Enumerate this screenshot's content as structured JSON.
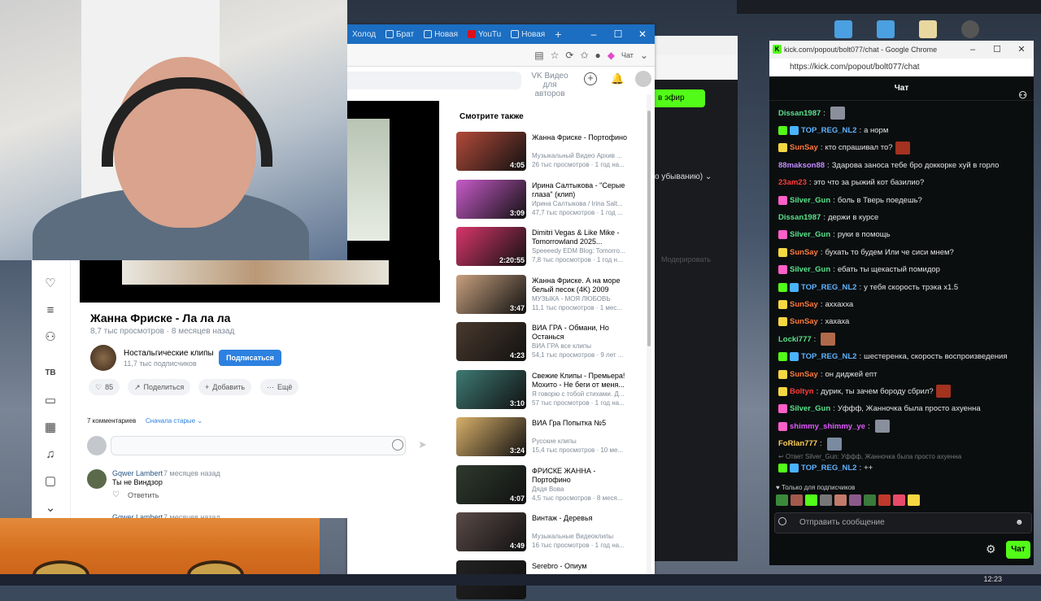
{
  "vk_window": {
    "tabs": [
      "Холод",
      "Брат",
      "Новая",
      "YouTu",
      "Новая"
    ],
    "header_title": "VK Видео для авторов",
    "video": {
      "title": "Жанна Фриске - Ла ла ла",
      "views": "8,7 тыс просмотров",
      "dot": "·",
      "age": "8 месяцев назад",
      "channel": "Ностальгические клипы",
      "subscribers": "11,7 тыс подписчиков",
      "subscribe_label": "Подписаться",
      "likes": "85",
      "share_label": "Поделиться",
      "add_label": "Добавить",
      "more_label": "Ещё"
    },
    "comments": {
      "count_label": "7 комментариев",
      "sort_label": "Сначала старые",
      "list": [
        {
          "author": "Gqwer Lambert",
          "time": "7 месяцев назад",
          "text": "Ты не Виндзор",
          "reply_label": "Ответить"
        },
        {
          "author": "Gqwer Lambert",
          "time": "7 месяцев назад"
        }
      ]
    },
    "recommendations_title": "Смотрите также",
    "recommendations": [
      {
        "title": "Жанна Фриске - Портофино",
        "channel": "Музыкальный Видео Архив ...",
        "meta": "26 тыс просмотров · 1 год на...",
        "duration": "4:05",
        "color": "#b24a3a"
      },
      {
        "title": "Ирина Салтыкова - \"Серые глаза\" (клип)",
        "channel": "Ирина Салтыкова / Irina Salt...",
        "meta": "47,7 тыс просмотров · 1 год ...",
        "duration": "3:09",
        "color": "#c85bc9"
      },
      {
        "title": "Dimitri Vegas & Like Mike - Tomorrowland 2025...",
        "channel": "Speeeedy EDM Blog: Tomorro...",
        "meta": "7,8 тыс просмотров · 1 год н...",
        "duration": "2:20:55",
        "color": "#d8366b"
      },
      {
        "title": "Жанна Фриске. А на море белый песок (4K) 2009",
        "channel": "МУЗЫКА - МОЯ ЛЮБОВЬ",
        "meta": "11,1 тыс просмотров · 1 мес...",
        "duration": "3:47",
        "color": "#c7a07e"
      },
      {
        "title": "ВИА ГРА - Обмани, Но Останься",
        "channel": "ВИА ГРА все клипы",
        "meta": "54,1 тыс просмотров · 9 лет ...",
        "duration": "4:23",
        "color": "#4a3a2e"
      },
      {
        "title": "Свежие Клипы - Премьера! Мохито - Не беги от меня...",
        "channel": "Я говорю с тобой стихами. Д...",
        "meta": "57 тыс просмотров · 1 год на...",
        "duration": "3:10",
        "color": "#3e7a74"
      },
      {
        "title": "ВИА Гра Попытка №5",
        "channel": "Русские клипы",
        "meta": "15,4 тыс просмотров · 10 ме...",
        "duration": "3:24",
        "color": "#d9b06a"
      },
      {
        "title": "ФРИСКЕ ЖАННА - Портофино",
        "channel": "Дядя Вова",
        "meta": "4,5 тыс просмотров · 8 меся...",
        "duration": "4:07",
        "color": "#2e3a2e"
      },
      {
        "title": "Винтаж - Деревья",
        "channel": "Музыкальные Видеоклипы",
        "meta": "16 тыс просмотров · 1 год на...",
        "duration": "4:49",
        "color": "#5a4a48"
      },
      {
        "title": "Serebro - Опиум",
        "channel": "",
        "meta": "",
        "duration": "",
        "color": "#222222"
      }
    ]
  },
  "mid_window": {
    "live_label": "в эфир",
    "sort_label": "о убыванию)",
    "moderate_label": "Модерировать"
  },
  "chat_window": {
    "title": "kick.com/popout/bolt077/chat - Google Chrome",
    "url": "https://kick.com/popout/bolt077/chat",
    "header": "Чат",
    "messages": [
      {
        "user": "Dissan1987",
        "badges": [],
        "color": "#5be28c",
        "text": "",
        "emote": "#8a8f9c"
      },
      {
        "user": "TOP_REG_NL2",
        "badges": [
          "#53fc18",
          "#4ab3ff"
        ],
        "color": "#5fb3ff",
        "text": "а норм"
      },
      {
        "user": "SunSay",
        "badges": [
          "#f5d742"
        ],
        "color": "#ff7a3d",
        "text": "кто спрашивал то?",
        "emote": "#a3321f"
      },
      {
        "user": "88makson88",
        "badges": [],
        "color": "#c18cff",
        "text": "Здарова заноса тебе бро доккорке хуй в горло"
      },
      {
        "user": "23am23",
        "badges": [],
        "color": "#ff3a3a",
        "text": "это что за рыжий кот базилио?"
      },
      {
        "user": "Silver_Gun",
        "badges": [
          "#ff5fc8"
        ],
        "color": "#5be28c",
        "text": "боль в Тверь поедешь?"
      },
      {
        "user": "Dissan1987",
        "badges": [],
        "color": "#5be28c",
        "text": "держи в курсе"
      },
      {
        "user": "Silver_Gun",
        "badges": [
          "#ff5fc8"
        ],
        "color": "#5be28c",
        "text": "руки в помощь"
      },
      {
        "user": "SunSay",
        "badges": [
          "#f5d742"
        ],
        "color": "#ff7a3d",
        "text": "бухать то будем Или че сиси мнем?"
      },
      {
        "user": "Silver_Gun",
        "badges": [
          "#ff5fc8"
        ],
        "color": "#5be28c",
        "text": "ебать ты щекастый помидор"
      },
      {
        "user": "TOP_REG_NL2",
        "badges": [
          "#53fc18",
          "#4ab3ff"
        ],
        "color": "#5fb3ff",
        "text": "у тебя скорость трэка x1.5"
      },
      {
        "user": "SunSay",
        "badges": [
          "#f5d742"
        ],
        "color": "#ff7a3d",
        "text": "аххахха"
      },
      {
        "user": "SunSay",
        "badges": [
          "#f5d742"
        ],
        "color": "#ff7a3d",
        "text": "хахаха"
      },
      {
        "user": "Locki777",
        "badges": [],
        "color": "#5be28c",
        "text": "",
        "emote": "#b06a4a"
      },
      {
        "user": "TOP_REG_NL2",
        "badges": [
          "#53fc18",
          "#4ab3ff"
        ],
        "color": "#5fb3ff",
        "text": "шестеренка, скорость воспроизведения"
      },
      {
        "user": "SunSay",
        "badges": [
          "#f5d742"
        ],
        "color": "#ff7a3d",
        "text": "он диджей епт"
      },
      {
        "user": "Boltyn",
        "badges": [
          "#f5d742"
        ],
        "color": "#ff3a3a",
        "text": "дурик, ты зачем бороду сбрил?",
        "emote": "#a3321f"
      },
      {
        "user": "Silver_Gun",
        "badges": [
          "#ff5fc8"
        ],
        "color": "#5be28c",
        "text": "Уффф, Жанночка была просто ахуенна"
      },
      {
        "user": "shimmy_shimmy_ye",
        "badges": [
          "#ff5fc8"
        ],
        "color": "#e25bff",
        "text": "",
        "emote": "#8a8f9c"
      },
      {
        "user": "FoRlan777",
        "badges": [],
        "color": "#ffcf5a",
        "text": "",
        "emote": "#7a8aa0"
      }
    ],
    "reply_to": "Ответ Silver_Gun: Уффф, Жанночка была просто ахуенна",
    "last_message": {
      "user": "TOP_REG_NL2",
      "text": "++"
    },
    "subs_only": "Только для подписчиков",
    "input_placeholder": "Отправить сообщение",
    "send_label": "Чат"
  },
  "taskbar": {
    "clock": "12:23"
  }
}
